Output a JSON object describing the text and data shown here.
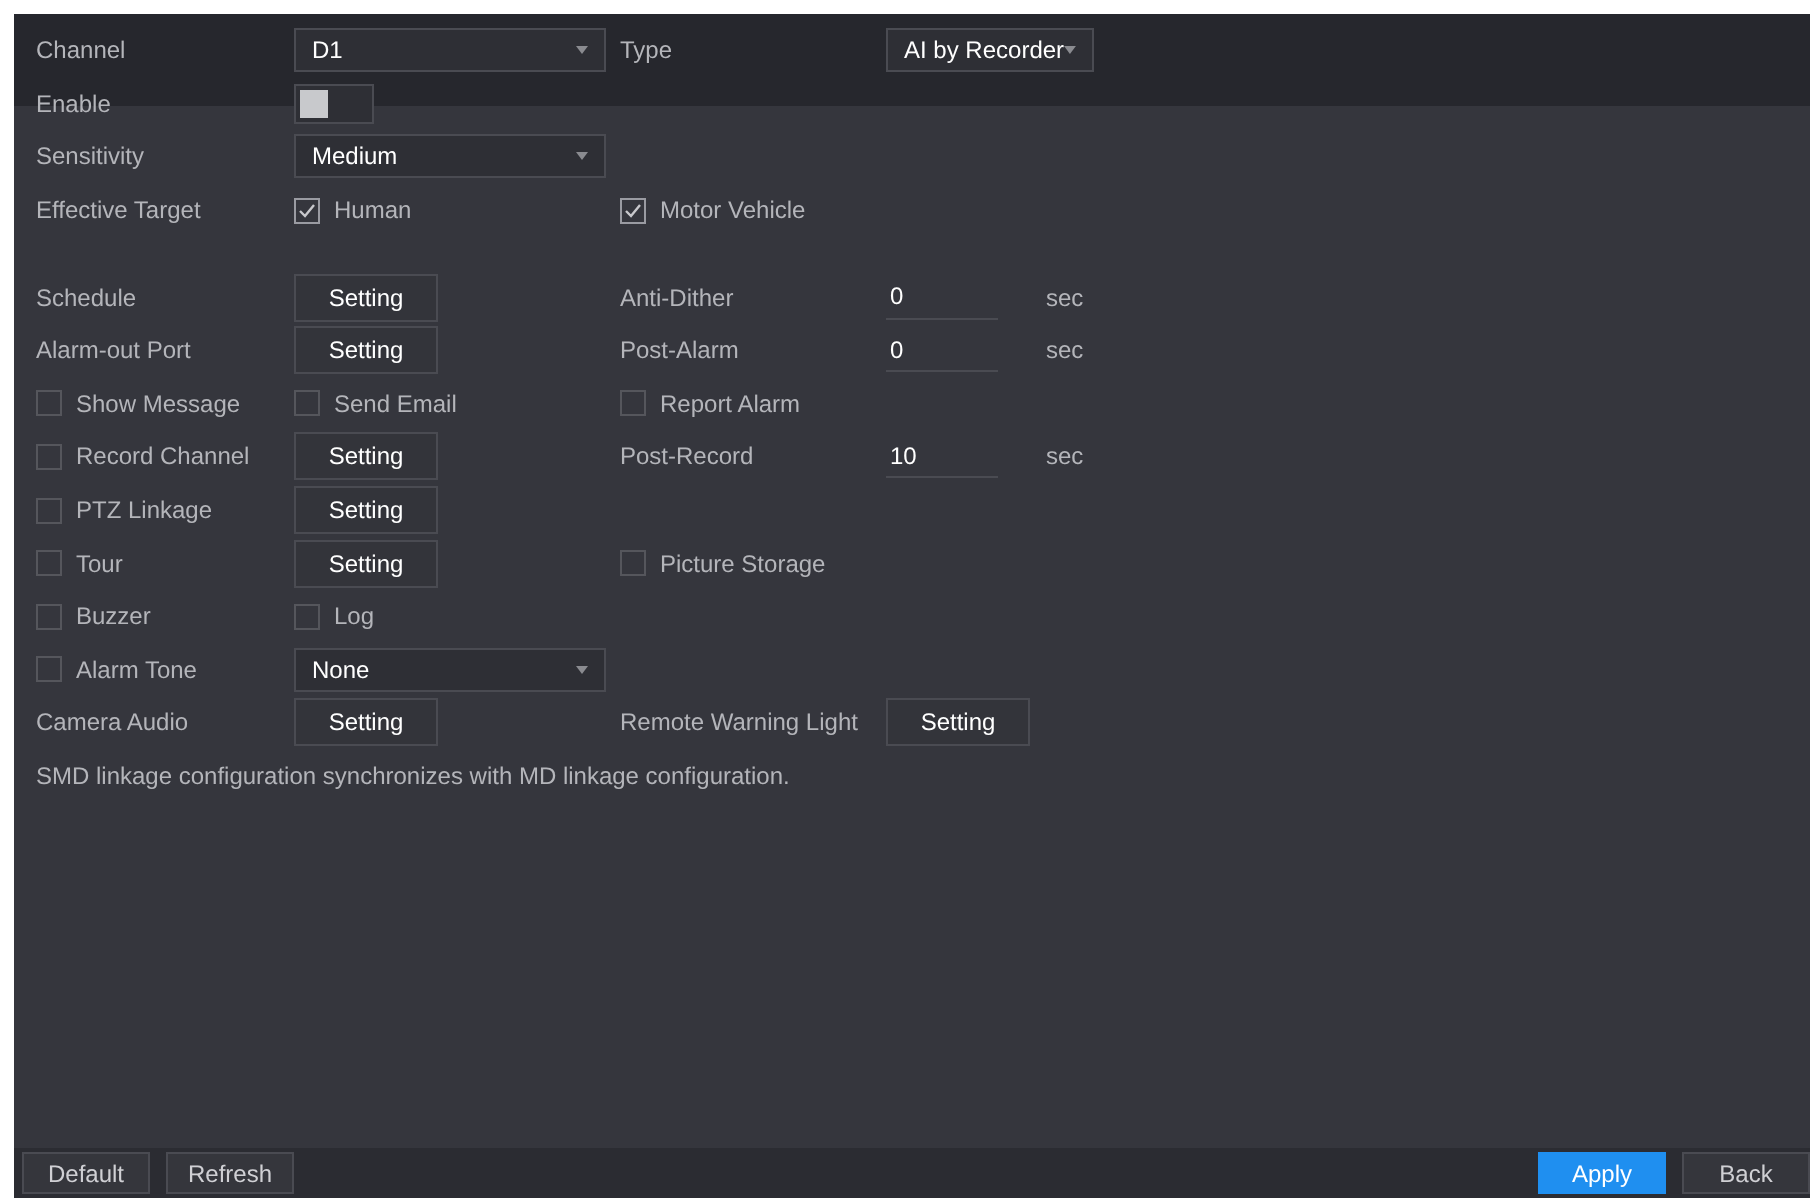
{
  "rows": [
    {
      "label": {
        "kind": "text",
        "text": "Channel"
      },
      "control": {
        "kind": "select",
        "value": "D1"
      },
      "label_2": {
        "kind": "text",
        "text": "Type"
      },
      "control_2": {
        "kind": "select_small",
        "value": "AI by Recorder"
      }
    },
    {
      "label": {
        "kind": "text",
        "text": "Enable"
      },
      "control": {
        "kind": "toggle",
        "on": false
      }
    },
    {
      "label": {
        "kind": "text",
        "text": "Sensitivity"
      },
      "control": {
        "kind": "select",
        "value": "Medium"
      }
    },
    {
      "label": {
        "kind": "text",
        "text": "Effective Target"
      },
      "control": {
        "kind": "check",
        "text": "Human",
        "checked": true
      },
      "label_2": {
        "kind": "check",
        "text": "Motor Vehicle",
        "checked": true
      }
    },
    {
      "kind": "spacer"
    },
    {
      "label": {
        "kind": "text",
        "text": "Schedule"
      },
      "control": {
        "kind": "button",
        "text": "Setting"
      },
      "label_2": {
        "kind": "text",
        "text": "Anti-Dither"
      },
      "control_2": {
        "kind": "number",
        "value": "0",
        "unit": "sec"
      }
    },
    {
      "label": {
        "kind": "text",
        "text": "Alarm-out Port"
      },
      "control": {
        "kind": "button",
        "text": "Setting"
      },
      "label_2": {
        "kind": "text",
        "text": "Post-Alarm"
      },
      "control_2": {
        "kind": "number",
        "value": "0",
        "unit": "sec"
      }
    },
    {
      "label": {
        "kind": "check",
        "text": "Show Message",
        "checked": false
      },
      "control": {
        "kind": "check",
        "text": "Send Email",
        "checked": false
      },
      "label_2": {
        "kind": "check",
        "text": "Report Alarm",
        "checked": false
      }
    },
    {
      "label": {
        "kind": "check",
        "text": "Record Channel",
        "checked": false
      },
      "control": {
        "kind": "button",
        "text": "Setting"
      },
      "label_2": {
        "kind": "text",
        "text": "Post-Record"
      },
      "control_2": {
        "kind": "number",
        "value": "10",
        "unit": "sec"
      }
    },
    {
      "label": {
        "kind": "check",
        "text": "PTZ Linkage",
        "checked": false
      },
      "control": {
        "kind": "button",
        "text": "Setting"
      }
    },
    {
      "label": {
        "kind": "check",
        "text": "Tour",
        "checked": false
      },
      "control": {
        "kind": "button",
        "text": "Setting"
      },
      "label_2": {
        "kind": "check",
        "text": "Picture Storage",
        "checked": false
      }
    },
    {
      "label": {
        "kind": "check",
        "text": "Buzzer",
        "checked": false
      },
      "control": {
        "kind": "check",
        "text": "Log",
        "checked": false
      }
    },
    {
      "label": {
        "kind": "check",
        "text": "Alarm Tone",
        "checked": false
      },
      "control": {
        "kind": "select",
        "value": "None"
      }
    },
    {
      "label": {
        "kind": "text",
        "text": "Camera Audio"
      },
      "control": {
        "kind": "button",
        "text": "Setting"
      },
      "label_2": {
        "kind": "text",
        "text": "Remote Warning Light"
      },
      "control_2": {
        "kind": "button",
        "text": "Setting"
      }
    }
  ],
  "note": "SMD linkage configuration synchronizes with MD linkage configuration.",
  "footer": {
    "left": [
      {
        "label": "Default",
        "kind": "normal"
      },
      {
        "label": "Refresh",
        "kind": "normal"
      }
    ],
    "right": [
      {
        "label": "Apply",
        "kind": "primary"
      },
      {
        "label": "Back",
        "kind": "normal"
      }
    ]
  }
}
